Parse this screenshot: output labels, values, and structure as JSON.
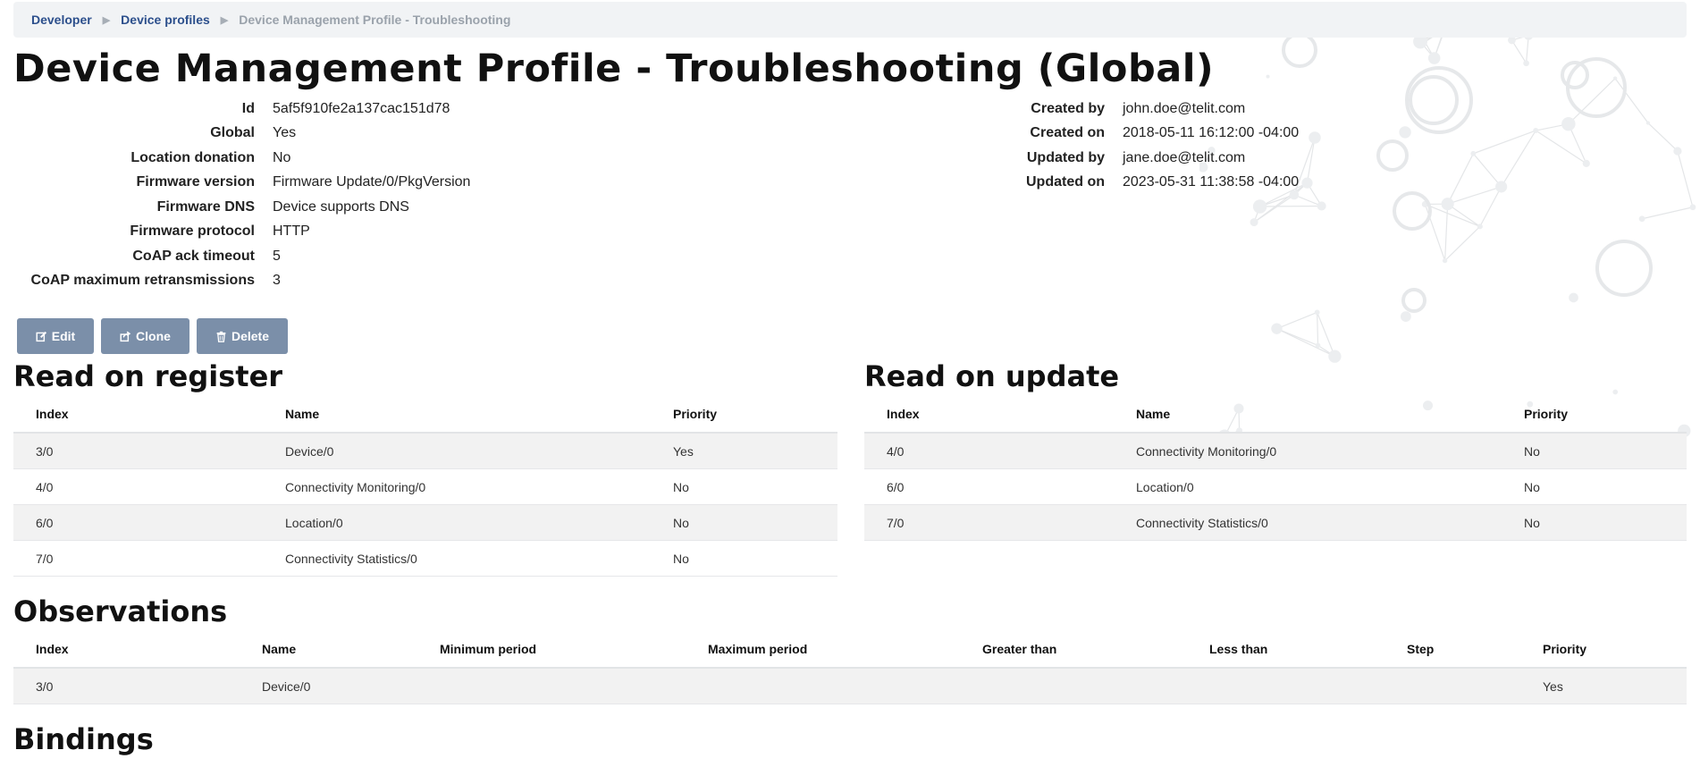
{
  "breadcrumb": {
    "items": [
      "Developer",
      "Device profiles"
    ],
    "current": "Device Management Profile - Troubleshooting"
  },
  "title": "Device Management Profile - Troubleshooting (Global)",
  "properties_left": [
    {
      "label": "Id",
      "value": "5af5f910fe2a137cac151d78"
    },
    {
      "label": "Global",
      "value": "Yes"
    },
    {
      "label": "Location donation",
      "value": "No"
    },
    {
      "label": "Firmware version",
      "value": "Firmware Update/0/PkgVersion"
    },
    {
      "label": "Firmware DNS",
      "value": "Device supports DNS"
    },
    {
      "label": "Firmware protocol",
      "value": "HTTP"
    },
    {
      "label": "CoAP ack timeout",
      "value": "5"
    },
    {
      "label": "CoAP maximum retransmissions",
      "value": "3"
    }
  ],
  "properties_right": [
    {
      "label": "Created by",
      "value": "john.doe@telit.com"
    },
    {
      "label": "Created on",
      "value": "2018-05-11 16:12:00 -04:00"
    },
    {
      "label": "Updated by",
      "value": "jane.doe@telit.com"
    },
    {
      "label": "Updated on",
      "value": "2023-05-31 11:38:58 -04:00"
    }
  ],
  "actions": {
    "edit": "Edit",
    "clone": "Clone",
    "delete": "Delete"
  },
  "read_on_register": {
    "heading": "Read on register",
    "columns": [
      "Index",
      "Name",
      "Priority"
    ],
    "rows": [
      [
        "3/0",
        "Device/0",
        "Yes"
      ],
      [
        "4/0",
        "Connectivity Monitoring/0",
        "No"
      ],
      [
        "6/0",
        "Location/0",
        "No"
      ],
      [
        "7/0",
        "Connectivity Statistics/0",
        "No"
      ]
    ]
  },
  "read_on_update": {
    "heading": "Read on update",
    "columns": [
      "Index",
      "Name",
      "Priority"
    ],
    "rows": [
      [
        "4/0",
        "Connectivity Monitoring/0",
        "No"
      ],
      [
        "6/0",
        "Location/0",
        "No"
      ],
      [
        "7/0",
        "Connectivity Statistics/0",
        "No"
      ]
    ]
  },
  "observations": {
    "heading": "Observations",
    "columns": [
      "Index",
      "Name",
      "Minimum period",
      "Maximum period",
      "Greater than",
      "Less than",
      "Step",
      "Priority"
    ],
    "rows": [
      [
        "3/0",
        "Device/0",
        "",
        "",
        "",
        "",
        "",
        "Yes"
      ]
    ]
  },
  "bindings": {
    "heading": "Bindings"
  },
  "colors": {
    "button": "#7b8fa9",
    "breadcrumb_link": "#2c4f8c",
    "breadcrumb_bg": "#f1f3f5"
  },
  "icons": {
    "edit": "edit-icon",
    "clone": "share-icon",
    "delete": "trash-icon"
  }
}
